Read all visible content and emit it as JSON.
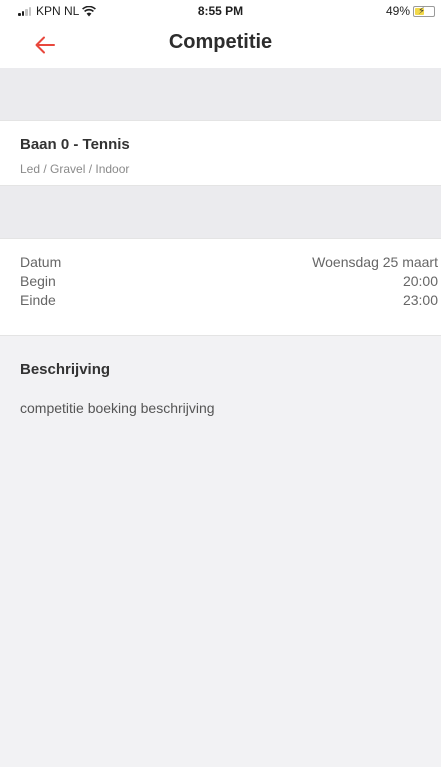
{
  "status_bar": {
    "carrier": "KPN NL",
    "time": "8:55 PM",
    "battery_percent": "49%",
    "battery_level": 0.49,
    "battery_color": "#f2d94a"
  },
  "header": {
    "title": "Competitie",
    "back_icon": "arrow-left-icon",
    "accent_color": "#e8473c"
  },
  "court": {
    "name": "Baan 0 - Tennis",
    "details": "Led / Gravel / Indoor"
  },
  "booking": {
    "rows": [
      {
        "label": "Datum",
        "value": "Woensdag 25 maart"
      },
      {
        "label": "Begin",
        "value": "20:00"
      },
      {
        "label": "Einde",
        "value": "23:00"
      }
    ]
  },
  "description": {
    "title": "Beschrijving",
    "text": "competitie boeking beschrijving"
  }
}
